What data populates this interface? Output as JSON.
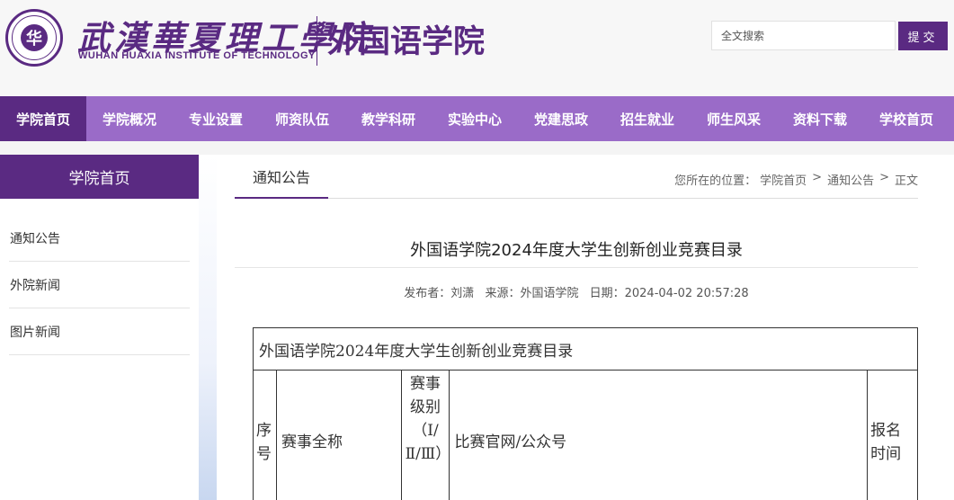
{
  "header": {
    "logo_glyph": "华",
    "university_cn": "武漢華夏理工學院",
    "university_en": "WUHAN HUAXIA INSTITUTE OF TECHNOLOGY",
    "college_name": "外国语学院",
    "search_placeholder": "全文搜索",
    "search_button": "提交"
  },
  "nav": {
    "items": [
      {
        "label": "学院首页",
        "active": true
      },
      {
        "label": "学院概况"
      },
      {
        "label": "专业设置"
      },
      {
        "label": "师资队伍"
      },
      {
        "label": "教学科研"
      },
      {
        "label": "实验中心"
      },
      {
        "label": "党建思政"
      },
      {
        "label": "招生就业"
      },
      {
        "label": "师生风采"
      },
      {
        "label": "资料下载"
      },
      {
        "label": "学校首页"
      }
    ]
  },
  "sidebar": {
    "title": "学院首页",
    "items": [
      {
        "label": "通知公告"
      },
      {
        "label": "外院新闻"
      },
      {
        "label": "图片新闻"
      }
    ]
  },
  "main": {
    "tab": "通知公告",
    "breadcrumb": {
      "prefix": "您所在的位置：",
      "items": [
        "学院首页",
        "通知公告",
        "正文"
      ],
      "separator": ">"
    },
    "article": {
      "title": "外国语学院2024年度大学生创新创业竞赛目录",
      "meta": {
        "author": "发布者：刘潇",
        "source": "来源：外国语学院",
        "date": "日期：2024-04-02 20:57:28"
      }
    },
    "table": {
      "caption": "外国语学院2024年度大学生创新创业竞赛目录",
      "headers": [
        "序号",
        "赛事全称",
        "赛事级别（Ⅰ/Ⅱ/Ⅲ）",
        "比赛官网/公众号",
        "报名时间"
      ]
    }
  },
  "colors": {
    "brand_purple": "#5a2a82",
    "nav_purple": "#9a6bc8"
  }
}
